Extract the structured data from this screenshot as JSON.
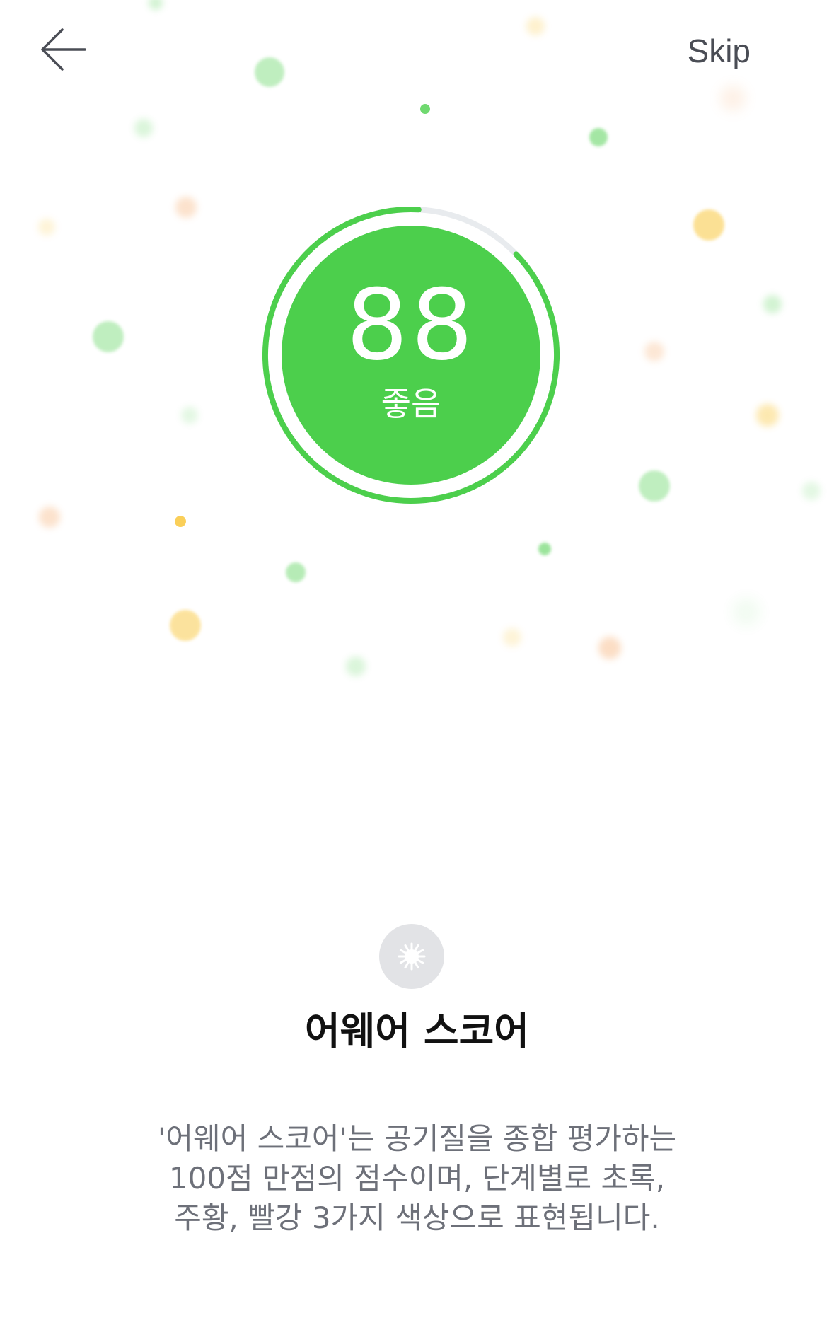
{
  "header": {
    "back_icon": "arrow-left-icon",
    "skip_label": "Skip"
  },
  "score": {
    "value": "88",
    "grade": "좋음",
    "max": 100,
    "progress": 0.88,
    "color": "#4CCF4C",
    "track_color": "#E8EBEE"
  },
  "feature": {
    "icon": "virus-icon",
    "title": "어웨어 스코어",
    "description_lines": [
      "'어웨어 스코어'는 공기질을 종합 평가하는",
      "100점 만점의 점수이며, 단계별로 초록,",
      "주황, 빨강 3가지 색상으로 표현됩니다."
    ]
  },
  "colors": {
    "green": "#4CCF4C",
    "orange": "#F5A05A",
    "yellow": "#F9C73C",
    "text_primary": "#111111",
    "text_secondary": "#6D7079"
  }
}
